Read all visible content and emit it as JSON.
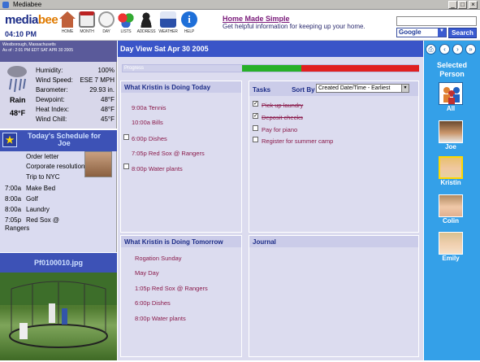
{
  "window": {
    "title": "Mediabee",
    "buttons": [
      "_",
      "□",
      "×"
    ]
  },
  "header": {
    "logo_media": "media",
    "logo_bee": "bee",
    "clock": "04:10 PM",
    "nav": [
      {
        "label": "HOME",
        "icon": "home-icon",
        "color": "#c0603a"
      },
      {
        "label": "MONTH",
        "icon": "calendar-month-icon",
        "color": "#d9d9d9"
      },
      {
        "label": "DAY",
        "icon": "clock-icon",
        "color": "#e6e6e6"
      },
      {
        "label": "LISTS",
        "icon": "lists-icon",
        "color": "#e05050"
      },
      {
        "label": "ADDRESS",
        "icon": "address-person-icon",
        "color": "#222222"
      },
      {
        "label": "WEATHER",
        "icon": "weather-icon",
        "color": "#2a4fa8"
      },
      {
        "label": "HELP",
        "icon": "help-icon",
        "color": "#1e6fd8"
      }
    ],
    "ad": {
      "title": "Home Made Simple",
      "desc": "Get helpful information for keeping up your home."
    },
    "search": {
      "engine": "Google",
      "button": "Search",
      "value": ""
    }
  },
  "weather": {
    "location": "Westborough, Massachusetts",
    "asof": "As of : 2:01 PM EDT SAT APR 30 2005",
    "condition": "Rain",
    "temp": "48°F",
    "rows": [
      {
        "k": "Humidity:",
        "v": "100%"
      },
      {
        "k": "Wind Speed:",
        "v": "ESE 7 MPH"
      },
      {
        "k": "Barometer:",
        "v": "29.93 in."
      },
      {
        "k": "Dewpoint:",
        "v": "48°F"
      },
      {
        "k": "Heat Index:",
        "v": "48°F"
      },
      {
        "k": "Wind Chill:",
        "v": "45°F"
      }
    ]
  },
  "schedule": {
    "title_line1": "Today's Schedule for",
    "title_line2": "Joe",
    "items": [
      {
        "time": "",
        "text": "Order letter"
      },
      {
        "time": "",
        "text": "Corporate resolution"
      },
      {
        "time": "",
        "text": "Trip to NYC"
      },
      {
        "time": "7:00a",
        "text": "Make Bed"
      },
      {
        "time": "8:00a",
        "text": "Golf"
      },
      {
        "time": "8:00a",
        "text": "Laundry"
      },
      {
        "time": "7:05p",
        "text": "Red Sox @"
      },
      {
        "time": "",
        "text": "Rangers"
      }
    ]
  },
  "photo": {
    "filename": "Pf0100010.jpg"
  },
  "main": {
    "view_label": "Day View",
    "date": "Sat Apr 30 2005",
    "progress_label": "Progress",
    "progress_value": 0.3,
    "today_header": "What Kristin is Doing Today",
    "today_items": [
      {
        "time": "9:00a",
        "text": "Tennis",
        "checkbox": false
      },
      {
        "time": "10:00a",
        "text": "Bills",
        "checkbox": false
      },
      {
        "time": "6:00p",
        "text": "Dishes",
        "checkbox": true
      },
      {
        "time": "7:05p",
        "text": "Red Sox @ Rangers",
        "checkbox": false
      },
      {
        "time": "8:00p",
        "text": "Water plants",
        "checkbox": true
      }
    ],
    "tasks_header": "Tasks",
    "sort_label": "Sort By",
    "sort_value": "Created Date/Time - Earliest",
    "tasks": [
      {
        "text": "Pick up laundry",
        "done": true
      },
      {
        "text": "Deposit checks",
        "done": true
      },
      {
        "text": "Pay for piano",
        "done": false
      },
      {
        "text": "Register for summer camp",
        "done": false
      }
    ],
    "tomorrow_header": "What Kristin is Doing Tomorrow",
    "tomorrow_items": [
      {
        "time": "",
        "text": "Rogation Sunday"
      },
      {
        "time": "",
        "text": "May Day"
      },
      {
        "time": "1:05p",
        "text": "Red Sox @ Rangers"
      },
      {
        "time": "6:00p",
        "text": "Dishes"
      },
      {
        "time": "8:00p",
        "text": "Water plants"
      }
    ],
    "journal_header": "Journal"
  },
  "people": {
    "selected_label_1": "Selected",
    "selected_label_2": "Person",
    "list": [
      {
        "name": "All"
      },
      {
        "name": "Joe"
      },
      {
        "name": "Kristin"
      },
      {
        "name": "Colin"
      },
      {
        "name": "Emily"
      }
    ]
  }
}
